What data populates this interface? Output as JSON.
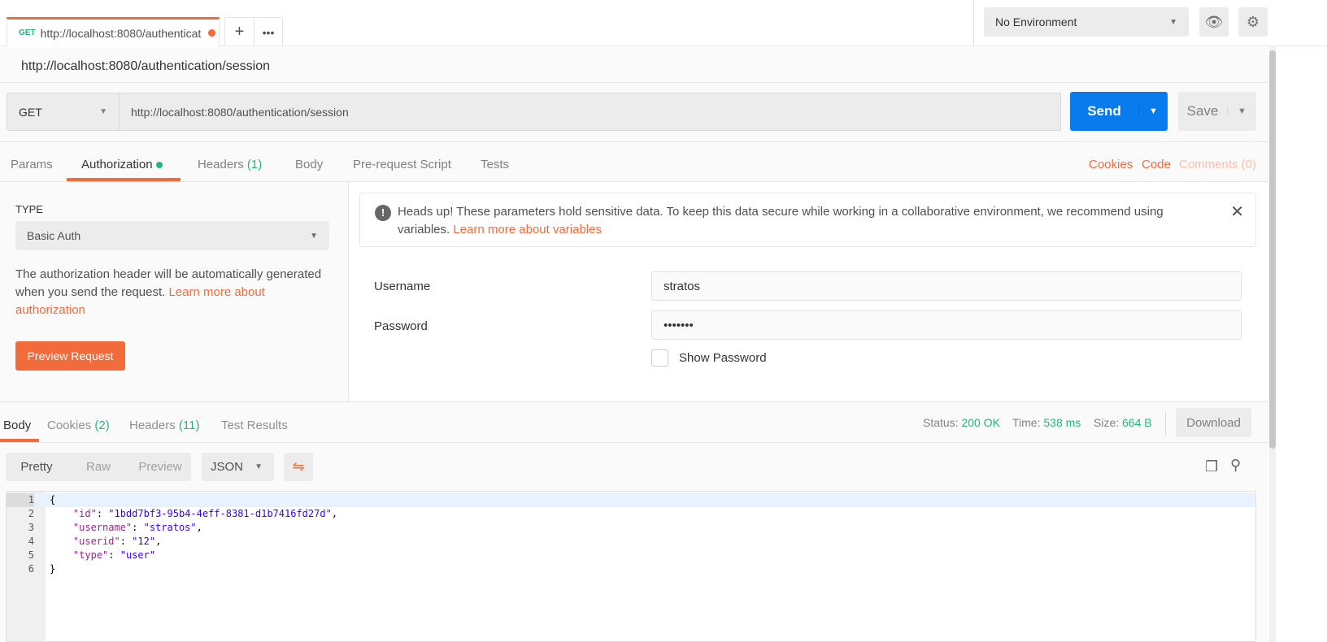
{
  "tab": {
    "method": "GET",
    "url": "http://localhost:8080/authenticat",
    "dot_color": "#f26b3a"
  },
  "environment": "No Environment",
  "request": {
    "title": "http://localhost:8080/authentication/session",
    "method": "GET",
    "url": "http://localhost:8080/authentication/session",
    "send": "Send",
    "save": "Save"
  },
  "req_tabs": [
    {
      "label": "Params"
    },
    {
      "label": "Authorization"
    },
    {
      "label": "Headers",
      "count": "(1)"
    },
    {
      "label": "Body"
    },
    {
      "label": "Pre-request Script"
    },
    {
      "label": "Tests"
    }
  ],
  "right_links": {
    "cookies": "Cookies",
    "code": "Code",
    "comments": "Comments (0)"
  },
  "auth": {
    "type_label": "TYPE",
    "type_value": "Basic Auth",
    "desc": "The authorization header will be automatically generated when you send the request. ",
    "desc_link": "Learn more about authorization",
    "preview": "Preview Request"
  },
  "alert": {
    "text": "Heads up! These parameters hold sensitive data. To keep this data secure while working in a collaborative environment, we recommend using variables. ",
    "link": "Learn more about variables"
  },
  "fields": {
    "username_label": "Username",
    "username": "stratos",
    "password_label": "Password",
    "password": "•••••••",
    "show_password": "Show Password"
  },
  "resp_tabs": [
    {
      "label": "Body"
    },
    {
      "label": "Cookies",
      "count": "(2)"
    },
    {
      "label": "Headers",
      "count": "(11)"
    },
    {
      "label": "Test Results"
    }
  ],
  "status": {
    "status_label": "Status:",
    "status": "200 OK",
    "time_label": "Time:",
    "time": "538 ms",
    "size_label": "Size:",
    "size": "664 B",
    "download": "Download"
  },
  "view": {
    "modes": [
      "Pretty",
      "Raw",
      "Preview"
    ],
    "format": "JSON"
  },
  "body_lines": [
    {
      "n": "1",
      "parts": [
        [
          "p",
          "{"
        ]
      ]
    },
    {
      "n": "2",
      "parts": [
        [
          "p",
          "    "
        ],
        [
          "k",
          "\"id\""
        ],
        [
          "p",
          ": "
        ],
        [
          "s",
          "\"1bdd7bf3-95b4-4eff-8381-d1b7416fd27d\""
        ],
        [
          "p",
          ","
        ]
      ]
    },
    {
      "n": "3",
      "parts": [
        [
          "p",
          "    "
        ],
        [
          "k",
          "\"username\""
        ],
        [
          "p",
          ": "
        ],
        [
          "s",
          "\"stratos\""
        ],
        [
          "p",
          ","
        ]
      ]
    },
    {
      "n": "4",
      "parts": [
        [
          "p",
          "    "
        ],
        [
          "k",
          "\"userid\""
        ],
        [
          "p",
          ": "
        ],
        [
          "s",
          "\"12\""
        ],
        [
          "p",
          ","
        ]
      ]
    },
    {
      "n": "5",
      "parts": [
        [
          "p",
          "    "
        ],
        [
          "k",
          "\"type\""
        ],
        [
          "p",
          ": "
        ],
        [
          "s",
          "\"user\""
        ]
      ]
    },
    {
      "n": "6",
      "parts": [
        [
          "p",
          "}"
        ]
      ]
    }
  ]
}
